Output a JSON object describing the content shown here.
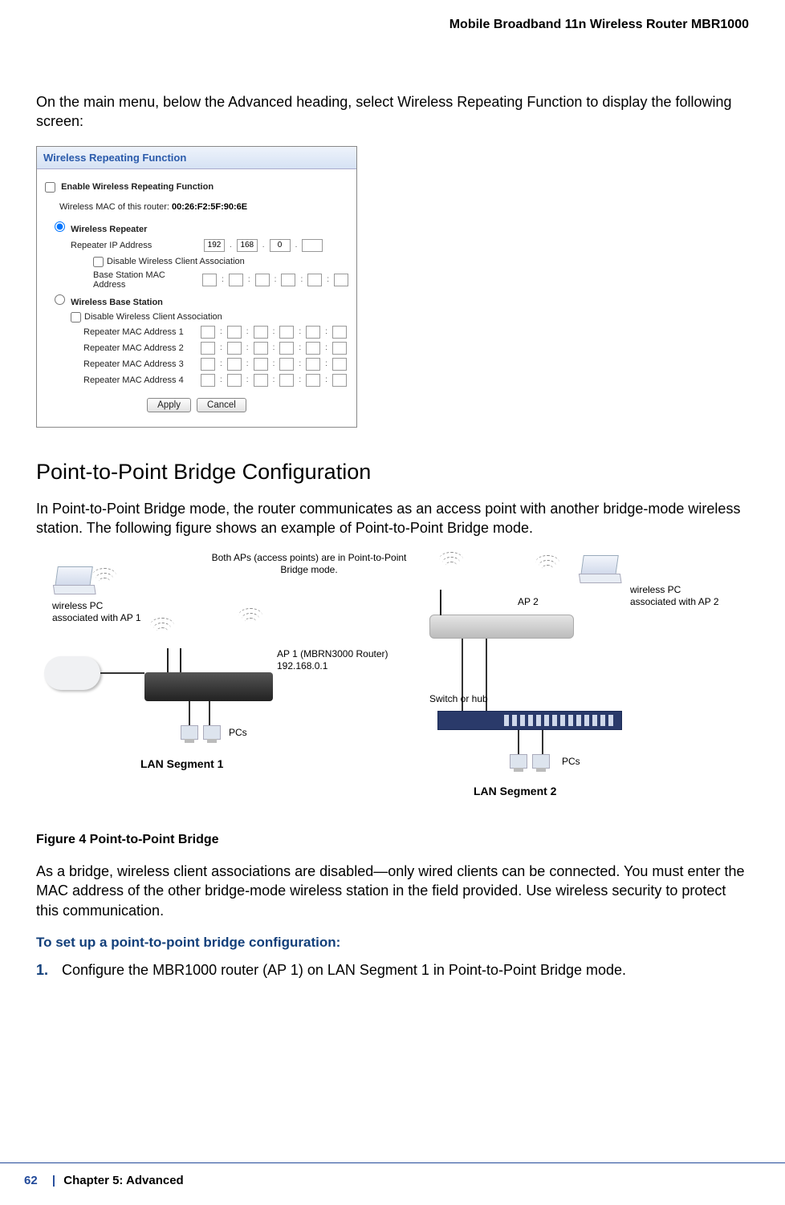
{
  "header_title": "Mobile Broadband 11n Wireless Router MBR1000",
  "intro_text": "On the main menu, below the Advanced heading, select Wireless Repeating Function to display the following screen:",
  "panel": {
    "title": "Wireless Repeating Function",
    "enable_label": "Enable Wireless Repeating Function",
    "mac_line_prefix": "Wireless MAC of this router:",
    "mac_value": "00:26:F2:5F:90:6E",
    "repeater": {
      "radio_label": "Wireless Repeater",
      "ip_label": "Repeater IP Address",
      "ip_octets": [
        "192",
        "168",
        "0",
        ""
      ],
      "disable_assoc": "Disable Wireless Client Association",
      "base_mac_label": "Base Station MAC Address"
    },
    "base": {
      "radio_label": "Wireless Base Station",
      "disable_assoc": "Disable Wireless Client Association",
      "mac_rows": [
        "Repeater MAC Address 1",
        "Repeater MAC Address 2",
        "Repeater MAC Address 3",
        "Repeater MAC Address 4"
      ]
    },
    "apply": "Apply",
    "cancel": "Cancel"
  },
  "section_heading": "Point-to-Point Bridge Configuration",
  "section_para1": "In Point-to-Point Bridge mode, the router communicates as an access point with another bridge-mode wireless station. The following figure shows an example of Point-to-Point Bridge mode.",
  "diagram": {
    "both_aps": "Both APs (access points) are in Point-to-Point Bridge mode.",
    "wpc_ap1_1": "wireless PC",
    "wpc_ap1_2": "associated with AP 1",
    "ap1_label": "AP 1 (MBRN3000 Router)",
    "ap1_ip": "192.168.0.1",
    "pcs": "PCs",
    "lan1": "LAN Segment 1",
    "ap2": "AP 2",
    "wpc_ap2_1": "wireless PC",
    "wpc_ap2_2": "associated with AP 2",
    "switch": "Switch or hub",
    "lan2": "LAN Segment 2"
  },
  "figure_caption": "Figure 4  Point-to-Point Bridge",
  "para_after_figure": "As a bridge, wireless client associations are disabled—only wired clients can be connected. You must enter the MAC address of the other bridge-mode wireless station in the field provided. Use wireless security to protect this communication.",
  "instruction_head": "To set up a point-to-point bridge configuration:",
  "step1": "Configure the MBR1000 router (AP 1) on LAN Segment 1 in Point-to-Point Bridge mode.",
  "footer": {
    "page_num": "62",
    "separator": "|",
    "chapter": "Chapter 5:  Advanced"
  }
}
